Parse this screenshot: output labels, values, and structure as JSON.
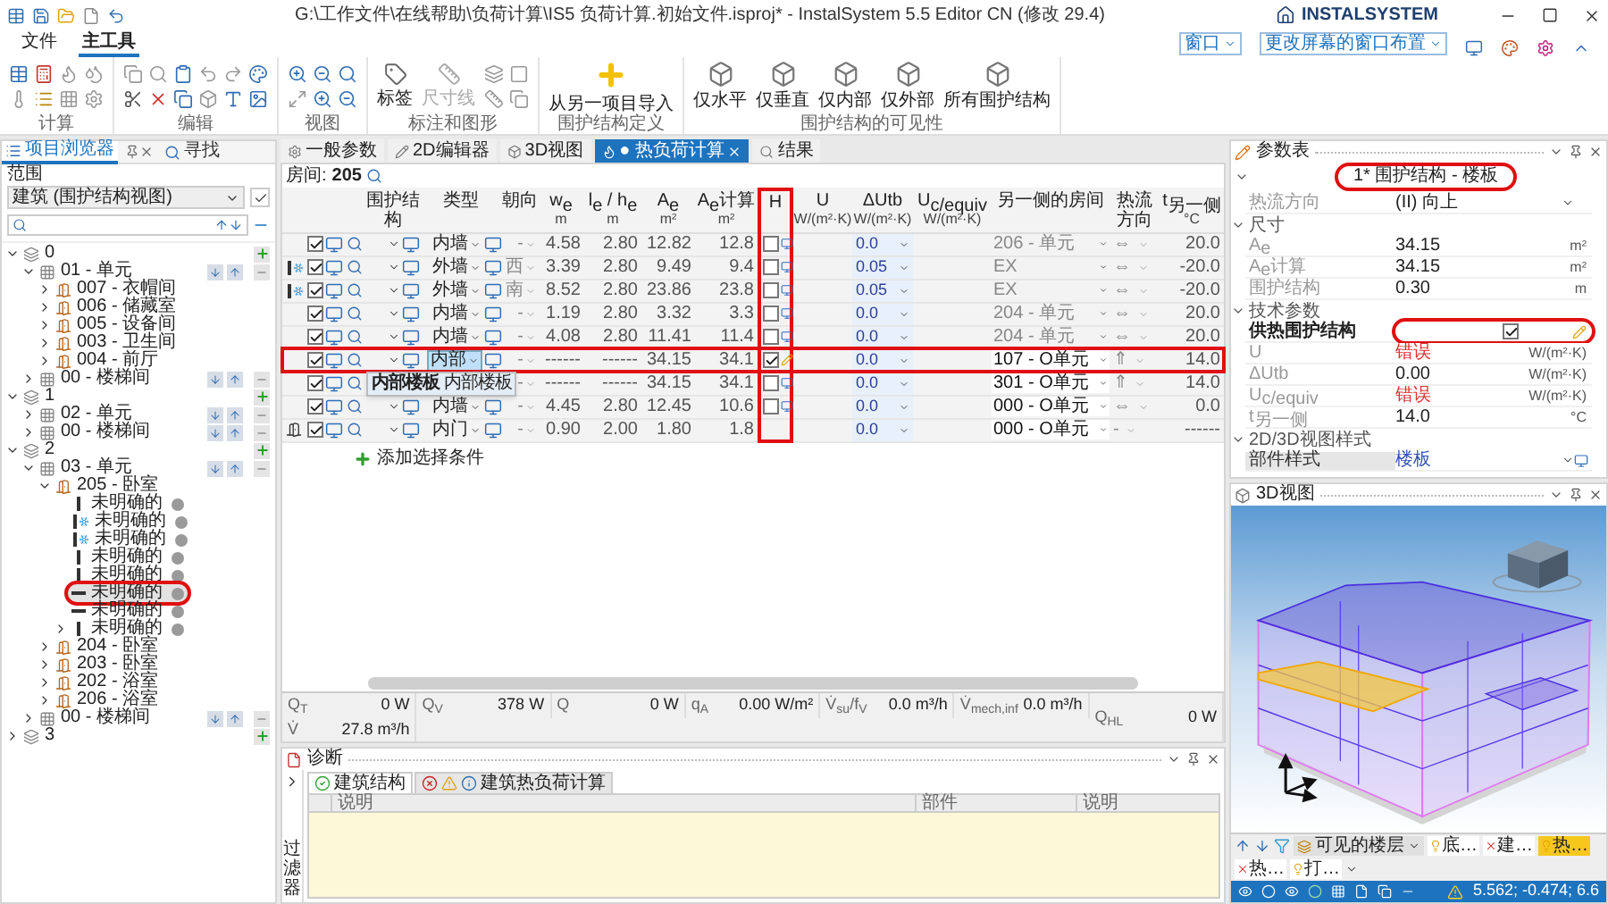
{
  "window": {
    "title": "G:\\工作文件\\在线帮助\\负荷计算\\IS5 负荷计算.初始文件.isproj* - InstalSystem 5.5 Editor CN (修改 29.4)",
    "logo": "INSTALSYSTEM"
  },
  "menu_tabs": [
    {
      "label": "文件",
      "selected": false
    },
    {
      "label": "主工具",
      "selected": true
    }
  ],
  "window_menus": [
    "窗口",
    "更改屏幕的窗口布置"
  ],
  "ribbon": [
    {
      "label": "计算",
      "kind": "calc"
    },
    {
      "label": "编辑",
      "kind": "edit"
    },
    {
      "label": "视图",
      "kind": "view"
    },
    {
      "label": "标注和图形",
      "kind": "annotate",
      "buttons": [
        {
          "label": "标签",
          "disabled": false
        },
        {
          "label": "尺寸线",
          "disabled": true
        }
      ]
    },
    {
      "label": "围护结构定义",
      "kind": "import",
      "buttons": [
        {
          "label": "从另一项目导入",
          "disabled": false
        }
      ]
    },
    {
      "label": "围护结构的可见性",
      "kind": "visibility",
      "buttons": [
        {
          "label": "仅水平",
          "disabled": false
        },
        {
          "label": "仅垂直",
          "disabled": false
        },
        {
          "label": "仅内部",
          "disabled": false
        },
        {
          "label": "仅外部",
          "disabled": false
        },
        {
          "label": "所有围护结构",
          "disabled": false
        }
      ]
    }
  ],
  "explorer": {
    "tabs": [
      {
        "label": "项目浏览器",
        "selected": true
      },
      {
        "label": "寻找",
        "selected": false
      }
    ],
    "scope_label": "范围",
    "scope_value": "建筑 (围护结构视图)",
    "tree": [
      {
        "label": "0",
        "kind": "floor",
        "expanded": true,
        "selected": false,
        "children": [
          {
            "label": "01 - 单元",
            "kind": "unit",
            "expanded": true,
            "selected": false,
            "children": [
              {
                "label": "007 - 衣帽间",
                "kind": "room",
                "expanded": false,
                "selected": false
              },
              {
                "label": "006 - 储藏室",
                "kind": "room",
                "expanded": false,
                "selected": false
              },
              {
                "label": "005 - 设备间",
                "kind": "room",
                "expanded": false,
                "selected": false
              },
              {
                "label": "003 - 卫生间",
                "kind": "room",
                "expanded": false,
                "selected": false
              },
              {
                "label": "004 - 前厅",
                "kind": "room",
                "expanded": false,
                "selected": false
              }
            ]
          },
          {
            "label": "00 - 楼梯间",
            "kind": "unit",
            "expanded": false,
            "selected": false
          }
        ]
      },
      {
        "label": "1",
        "kind": "floor",
        "expanded": true,
        "selected": false,
        "children": [
          {
            "label": "02 - 单元",
            "kind": "unit",
            "expanded": false,
            "selected": false
          },
          {
            "label": "00 - 楼梯间",
            "kind": "unit",
            "expanded": false,
            "selected": false
          }
        ]
      },
      {
        "label": "2",
        "kind": "floor",
        "expanded": true,
        "selected": false,
        "children": [
          {
            "label": "03 - 单元",
            "kind": "unit",
            "expanded": true,
            "selected": false,
            "children": [
              {
                "label": "205 - 卧室",
                "kind": "room",
                "expanded": true,
                "selected": false,
                "children": [
                  {
                    "label": "未明确的",
                    "kind": "wall",
                    "selected": false
                  },
                  {
                    "label": "未明确的",
                    "kind": "wall_ext",
                    "selected": false
                  },
                  {
                    "label": "未明确的",
                    "kind": "wall_ext",
                    "selected": false
                  },
                  {
                    "label": "未明确的",
                    "kind": "wall",
                    "selected": false
                  },
                  {
                    "label": "未明确的",
                    "kind": "wall",
                    "selected": false
                  },
                  {
                    "label": "未明确的",
                    "kind": "floor_slab",
                    "selected": true
                  },
                  {
                    "label": "未明确的",
                    "kind": "floor_slab",
                    "selected": false
                  },
                  {
                    "label": "未明确的",
                    "kind": "wall",
                    "expanded": false,
                    "selected": false
                  }
                ]
              },
              {
                "label": "204 - 卧室",
                "kind": "room",
                "expanded": false,
                "selected": false
              },
              {
                "label": "203 - 卧室",
                "kind": "room",
                "expanded": false,
                "selected": false
              },
              {
                "label": "202 - 浴室",
                "kind": "room",
                "expanded": false,
                "selected": false
              },
              {
                "label": "206 - 浴室",
                "kind": "room",
                "expanded": false,
                "selected": false
              }
            ]
          },
          {
            "label": "00 - 楼梯间",
            "kind": "unit",
            "expanded": false,
            "selected": false
          }
        ]
      },
      {
        "label": "3",
        "kind": "floor",
        "expanded": false,
        "selected": false
      }
    ]
  },
  "editor_tabs": [
    {
      "label": "一般参数",
      "selected": false
    },
    {
      "label": "2D编辑器",
      "selected": false
    },
    {
      "label": "3D视图",
      "selected": false
    },
    {
      "label": "● 热负荷计算",
      "selected": true
    },
    {
      "label": "结果",
      "selected": false
    }
  ],
  "room": {
    "label": "房间:",
    "value": "205"
  },
  "table": {
    "columns": [
      {
        "label": "围护结构",
        "highlighted": false
      },
      {
        "label": "类型",
        "highlighted": false
      },
      {
        "label": "朝向",
        "highlighted": false
      },
      {
        "label": "w$_{e}$",
        "unit": "m",
        "highlighted": false
      },
      {
        "label": "l$_{e}$ / h$_{e}$",
        "unit": "m",
        "highlighted": false
      },
      {
        "label": "A$_{e}$",
        "unit": "m²",
        "highlighted": false
      },
      {
        "label": "A$_{e}$计算",
        "unit": "m²",
        "highlighted": false
      },
      {
        "label": "H",
        "highlighted": true
      },
      {
        "label": "U",
        "unit": "W/(m²·K)",
        "highlighted": false
      },
      {
        "label": "ΔUtb",
        "unit": "W/(m²·K)",
        "highlighted": false
      },
      {
        "label": "U$_{c/equiv}$",
        "unit": "W/(m²·K)",
        "highlighted": false
      },
      {
        "label": "另一侧的房间",
        "highlighted": false
      },
      {
        "label": "热流方向",
        "highlighted": false
      },
      {
        "label": "t$_{另一侧}$",
        "unit": "°C",
        "highlighted": false
      }
    ],
    "rows": [
      {
        "kind": "wall",
        "enabled": true,
        "selected": false,
        "type": "内墙",
        "orientation": "-",
        "w": "4.58",
        "l": "2.80",
        "area": "12.82",
        "area_calc": "12.8",
        "h": false,
        "dutb": "0.0",
        "other_room": "206 - 单元",
        "room_editable": false,
        "flow": "⇔",
        "temp": "20.0"
      },
      {
        "kind": "wall_ext",
        "enabled": true,
        "selected": false,
        "type": "外墙",
        "orientation": "西",
        "w": "3.39",
        "l": "2.80",
        "area": "9.49",
        "area_calc": "9.4",
        "h": false,
        "dutb": "0.05",
        "other_room": "EX",
        "room_editable": false,
        "flow": "⇔",
        "temp": "-20.0"
      },
      {
        "kind": "wall_ext",
        "enabled": true,
        "selected": false,
        "type": "外墙",
        "orientation": "南",
        "w": "8.52",
        "l": "2.80",
        "area": "23.86",
        "area_calc": "23.8",
        "h": false,
        "dutb": "0.05",
        "other_room": "EX",
        "room_editable": false,
        "flow": "⇔",
        "temp": "-20.0"
      },
      {
        "kind": "wall",
        "enabled": true,
        "selected": false,
        "type": "内墙",
        "orientation": "-",
        "w": "1.19",
        "l": "2.80",
        "area": "3.32",
        "area_calc": "3.3",
        "h": false,
        "dutb": "0.0",
        "other_room": "204 - 单元",
        "room_editable": false,
        "flow": "⇔",
        "temp": "20.0"
      },
      {
        "kind": "wall",
        "enabled": true,
        "selected": false,
        "type": "内墙",
        "orientation": "-",
        "w": "4.08",
        "l": "2.80",
        "area": "11.41",
        "area_calc": "11.4",
        "h": false,
        "dutb": "0.0",
        "other_room": "204 - 单元",
        "room_editable": false,
        "flow": "⇔",
        "temp": "20.0"
      },
      {
        "kind": "floor_slab",
        "enabled": true,
        "selected": true,
        "type": "内部",
        "orientation": "-",
        "w": "------",
        "l": "------",
        "area": "34.15",
        "area_calc": "34.1",
        "h": true,
        "dutb": "0.0",
        "other_room": "107 - O单元",
        "room_editable": true,
        "flow": "⇑",
        "temp": "14.0"
      },
      {
        "kind": "floor_slab",
        "enabled": true,
        "selected": false,
        "orientation": "-",
        "w": "------",
        "l": "------",
        "area": "34.15",
        "area_calc": "34.1",
        "h": false,
        "dutb": "0.0",
        "other_room": "301 - O单元",
        "room_editable": true,
        "flow": "⇑",
        "temp": "14.0"
      },
      {
        "kind": "wall",
        "enabled": true,
        "selected": false,
        "type": "内墙",
        "orientation": "-",
        "w": "4.45",
        "l": "2.80",
        "area": "12.45",
        "area_calc": "10.6",
        "h": false,
        "dutb": "0.0",
        "other_room": "000 - O单元",
        "room_editable": true,
        "flow": "⇔",
        "temp": "0.0"
      },
      {
        "kind": "door",
        "enabled": true,
        "selected": false,
        "type": "内门",
        "orientation": "-",
        "w": "0.90",
        "l": "2.00",
        "area": "1.80",
        "area_calc": "1.8",
        "dutb": "0.0",
        "other_room": "000 - O单元",
        "room_editable": true,
        "flow": "-",
        "temp": "------"
      }
    ],
    "tooltip": "**内部楼板** 内部楼板",
    "add_condition": "添加选择条件"
  },
  "summary": [
    {
      "symbol": "Q$_{T}$",
      "value": "0 W",
      "kind": "value"
    },
    {
      "symbol": "Q$_{V}$",
      "value": "378 W",
      "kind": "value"
    },
    {
      "symbol": "Q",
      "value": "0 W",
      "kind": "value"
    },
    {
      "symbol": "q$_{A}$",
      "value": "0.00 W/m²",
      "kind": "value"
    },
    {
      "symbol": "V̇$_{su}$/f$_{V}$",
      "value": "0.0 m³/h",
      "kind": "value"
    },
    {
      "symbol": "V̇$_{mech,inf}$",
      "value": "0.0 m³/h",
      "kind": "value"
    },
    {
      "symbol": "Q$_{HL}$",
      "value": "0 W",
      "kind": "total"
    },
    {
      "symbol": "V̇",
      "value": "27.8 m³/h",
      "kind": "value"
    }
  ],
  "diagnostics": {
    "title": "诊断",
    "filter_label": "过滤器",
    "tabs": [
      {
        "label": "建筑结构",
        "kind": "ok",
        "selected": true
      },
      {
        "label": "建筑热负荷计算",
        "kind": "issues",
        "selected": false
      }
    ],
    "columns": [
      "说明",
      "部件",
      "说明"
    ]
  },
  "properties": {
    "title": "参数表",
    "header": "1* 围护结构 - 楼板",
    "header_highlighted": true,
    "rows": [
      {
        "kind": "select",
        "name": "热流方向",
        "value": "(II) 向上",
        "highlighted": false
      },
      {
        "kind": "section",
        "name": "尺寸",
        "expanded": true
      },
      {
        "kind": "value",
        "name": "A$_{e}$",
        "value": "34.15",
        "unit": "m²",
        "error": false,
        "highlighted": false
      },
      {
        "kind": "value",
        "name": "A$_{e}$计算",
        "value": "34.15",
        "unit": "m²",
        "error": false,
        "highlighted": false
      },
      {
        "kind": "value",
        "name": "围护结构",
        "value": "0.30",
        "unit": "m",
        "error": false,
        "highlighted": false
      },
      {
        "kind": "section",
        "name": "技术参数",
        "expanded": true
      },
      {
        "kind": "checkbox",
        "name": "供热围护结构",
        "checked": true,
        "highlighted": true
      },
      {
        "kind": "value",
        "name": "U",
        "value": "错误",
        "unit": "W/(m²·K)",
        "error": true,
        "highlighted": false
      },
      {
        "kind": "value",
        "name": "ΔUtb",
        "value": "0.00",
        "unit": "W/(m²·K)",
        "error": false,
        "highlighted": false
      },
      {
        "kind": "value",
        "name": "U$_{c/equiv}$",
        "value": "错误",
        "unit": "W/(m²·K)",
        "error": true,
        "highlighted": false
      },
      {
        "kind": "value",
        "name": "t$_{另一侧}$",
        "value": "14.0",
        "unit": "°C",
        "error": false,
        "highlighted": false
      },
      {
        "kind": "section",
        "name": "2D/3D视图样式",
        "expanded": true
      },
      {
        "kind": "style_select",
        "name": "部件样式",
        "value": "楼板",
        "highlighted": false
      }
    ]
  },
  "view3d": {
    "title": "3D视图",
    "floor_filter": "可见的楼层",
    "layer_tabs": [
      {
        "label": "底…",
        "kind": "light",
        "selected": false
      },
      {
        "label": "建…",
        "kind": "hidden",
        "selected": false
      },
      {
        "label": "热…",
        "kind": "light",
        "selected": true
      },
      {
        "label": "热…",
        "kind": "hidden",
        "selected": false
      },
      {
        "label": "打…",
        "kind": "light",
        "selected": false
      }
    ],
    "coordinates": "5.562; -0.474; 6.6"
  }
}
